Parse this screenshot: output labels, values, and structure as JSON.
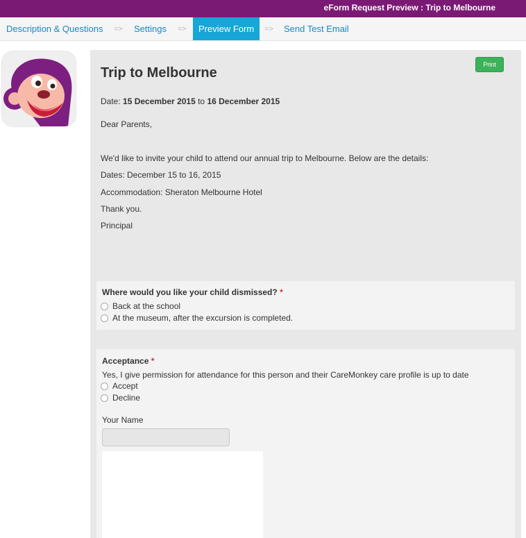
{
  "header": {
    "title": "eForm Request Preview : Trip to Melbourne"
  },
  "nav": {
    "items": [
      {
        "label": "Description & Questions"
      },
      {
        "label": "Settings"
      },
      {
        "label": "Preview Form",
        "active": true
      },
      {
        "label": "Send Test Email"
      }
    ],
    "separator": "=>"
  },
  "colors": {
    "brand": "#7b1a74",
    "nav_active": "#16a6d8",
    "link": "#1a87c2",
    "print_button": "#3cb25a",
    "required": "#d9302c"
  },
  "form": {
    "print_label": "Print",
    "title": "Trip to Melbourne",
    "date_prefix": "Date: ",
    "date_from": "15 December 2015",
    "date_connector": " to ",
    "date_to": "16 December 2015",
    "greeting": "Dear Parents,",
    "body": [
      "We'd like to invite your child to attend our annual trip to Melbourne. Below are the details:",
      "Dates: December 15 to 16, 2015",
      "Accommodation: Sheraton Melbourne Hotel",
      "Thank you.",
      "Principal"
    ]
  },
  "questions": {
    "dismissal": {
      "label": "Where would you like your child dismissed?",
      "required_mark": "*",
      "options": [
        "Back at the school",
        "At the museum, after the excursion is completed."
      ]
    },
    "acceptance": {
      "label": "Acceptance",
      "required_mark": "*",
      "statement": "Yes, I give permission for attendance for this person and their CareMonkey care profile is up to date",
      "options": [
        "Accept",
        "Decline"
      ],
      "name_label": "Your Name",
      "name_value": ""
    }
  }
}
